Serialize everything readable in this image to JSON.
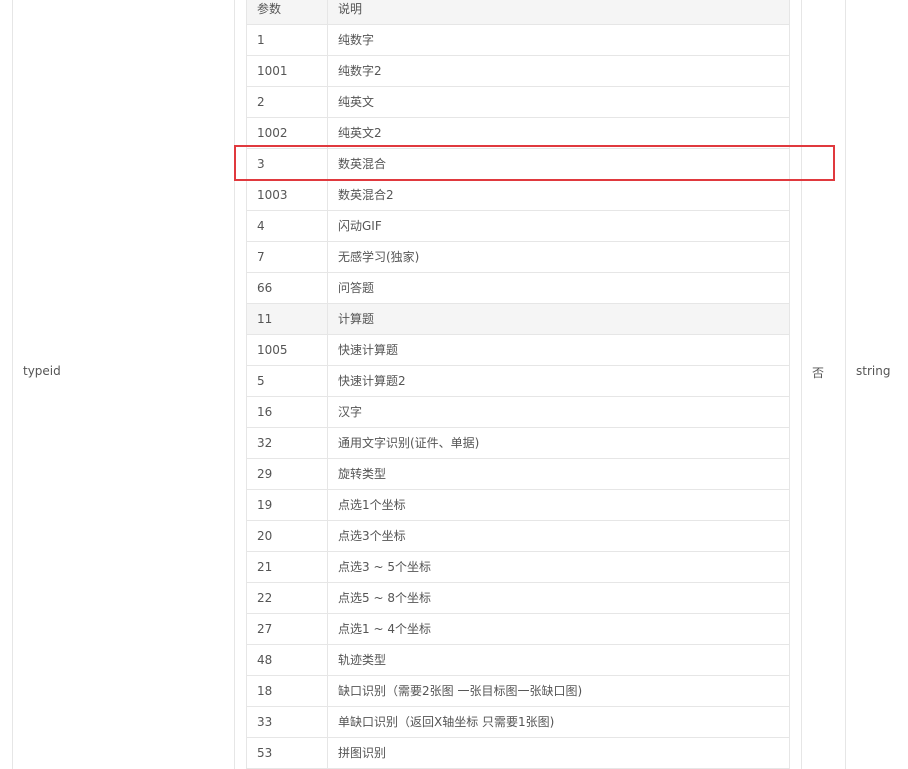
{
  "outer_row": {
    "param_name": "typeid",
    "required": "否",
    "type": "string"
  },
  "inner_table": {
    "headers": [
      "参数",
      "说明"
    ],
    "rows": [
      {
        "code": "1",
        "desc": "纯数字"
      },
      {
        "code": "1001",
        "desc": "纯数字2"
      },
      {
        "code": "2",
        "desc": "纯英文"
      },
      {
        "code": "1002",
        "desc": "纯英文2"
      },
      {
        "code": "3",
        "desc": "数英混合"
      },
      {
        "code": "1003",
        "desc": "数英混合2"
      },
      {
        "code": "4",
        "desc": "闪动GIF"
      },
      {
        "code": "7",
        "desc": "无感学习(独家)"
      },
      {
        "code": "66",
        "desc": "问答题"
      },
      {
        "code": "11",
        "desc": "计算题"
      },
      {
        "code": "1005",
        "desc": "快速计算题"
      },
      {
        "code": "5",
        "desc": "快速计算题2"
      },
      {
        "code": "16",
        "desc": "汉字"
      },
      {
        "code": "32",
        "desc": "通用文字识别(证件、单据)"
      },
      {
        "code": "29",
        "desc": "旋转类型"
      },
      {
        "code": "19",
        "desc": "点选1个坐标"
      },
      {
        "code": "20",
        "desc": "点选3个坐标"
      },
      {
        "code": "21",
        "desc": "点选3 ~ 5个坐标"
      },
      {
        "code": "22",
        "desc": "点选5 ~ 8个坐标"
      },
      {
        "code": "27",
        "desc": "点选1 ~ 4个坐标"
      },
      {
        "code": "48",
        "desc": "轨迹类型"
      },
      {
        "code": "18",
        "desc": "缺口识别（需要2张图 一张目标图一张缺口图)"
      },
      {
        "code": "33",
        "desc": "单缺口识别（返回X轴坐标 只需要1张图)"
      },
      {
        "code": "53",
        "desc": "拼图识别"
      }
    ]
  },
  "highlight_color": "#e0393e"
}
